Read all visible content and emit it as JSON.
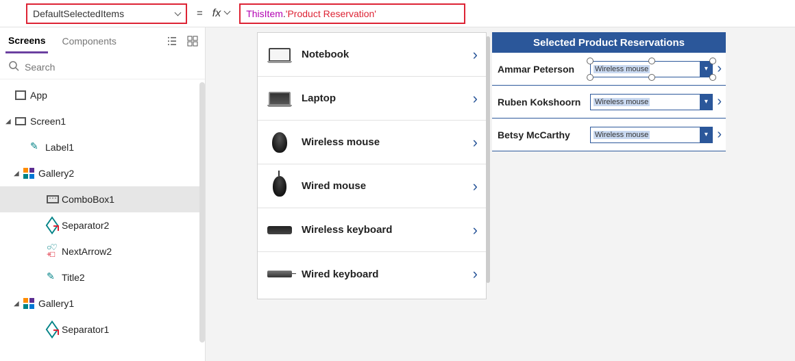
{
  "formula_bar": {
    "property": "DefaultSelectedItems",
    "equals": "=",
    "fx_label": "fx",
    "tok1": "ThisItem",
    "tok2": ".",
    "tok3": "'Product Reservation'"
  },
  "left_pane": {
    "tabs": {
      "screens": "Screens",
      "components": "Components"
    },
    "search_placeholder": "Search",
    "tree": {
      "app": "App",
      "screen1": "Screen1",
      "label1": "Label1",
      "gallery2": "Gallery2",
      "combobox1": "ComboBox1",
      "separator2": "Separator2",
      "nextarrow2": "NextArrow2",
      "title2": "Title2",
      "gallery1": "Gallery1",
      "separator1": "Separator1"
    }
  },
  "products": [
    {
      "name": "Notebook",
      "pic": "pic-notebook"
    },
    {
      "name": "Laptop",
      "pic": "pic-laptop"
    },
    {
      "name": "Wireless mouse",
      "pic": "pic-wmouse"
    },
    {
      "name": "Wired mouse",
      "pic": "pic-wiredmouse"
    },
    {
      "name": "Wireless keyboard",
      "pic": "pic-wkbd"
    },
    {
      "name": "Wired keyboard",
      "pic": "pic-wiredkbd"
    }
  ],
  "reservations": {
    "header": "Selected Product Reservations",
    "rows": [
      {
        "name": "Ammar Peterson",
        "value": "Wireless mouse",
        "selected": true
      },
      {
        "name": "Ruben Kokshoorn",
        "value": "Wireless mouse",
        "selected": false
      },
      {
        "name": "Betsy McCarthy",
        "value": "Wireless mouse",
        "selected": false
      }
    ]
  }
}
